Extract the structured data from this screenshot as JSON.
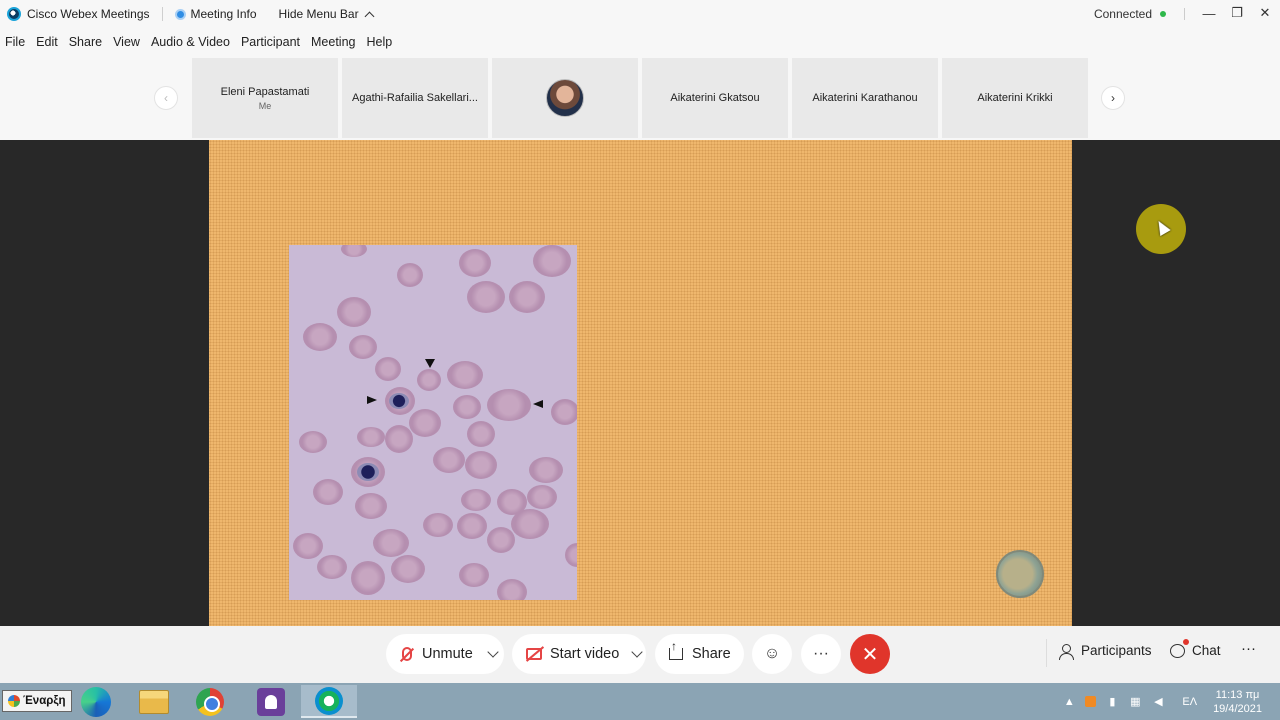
{
  "titlebar": {
    "app_title": "Cisco Webex Meetings",
    "meeting_info": "Meeting Info",
    "hide_menu_bar": "Hide Menu Bar",
    "status": "Connected"
  },
  "menu": [
    "File",
    "Edit",
    "Share",
    "View",
    "Audio & Video",
    "Participant",
    "Meeting",
    "Help"
  ],
  "filmstrip": {
    "participants": [
      {
        "name": "Eleni Papastamati",
        "sub": "Me"
      },
      {
        "name": "Agathi-Rafailia Sakellari...",
        "sub": ""
      },
      {
        "name": "",
        "sub": "",
        "avatar": "video-thumbnail"
      },
      {
        "name": "Aikaterini Gkatsou",
        "sub": ""
      },
      {
        "name": "Aikaterini Karathanou",
        "sub": ""
      },
      {
        "name": "Aikaterini Krikki",
        "sub": ""
      }
    ]
  },
  "controls": {
    "unmute": "Unmute",
    "start_video": "Start video",
    "share": "Share",
    "participants": "Participants",
    "chat": "Chat",
    "more": "···",
    "end": "✕",
    "reactions": "☺"
  },
  "taskbar": {
    "start": "Έναρξη",
    "language": "ΕΛ",
    "time": "11:13 πμ",
    "date": "19/4/2021"
  },
  "colors": {
    "slide_bg": "#efb76d",
    "stage_bg": "#282828",
    "end_button": "#e0352b",
    "muted_red": "#e54545",
    "connected_green": "#2eb84b"
  }
}
